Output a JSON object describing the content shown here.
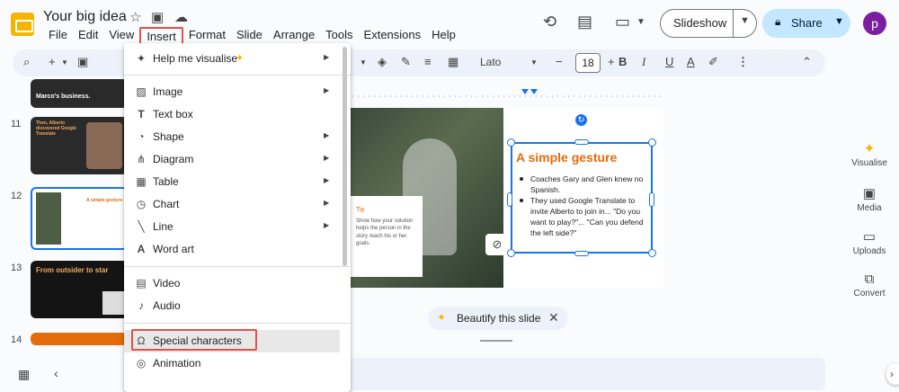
{
  "app": {
    "doc_title": "Your big idea",
    "menus": [
      "File",
      "Edit",
      "View",
      "Insert",
      "Format",
      "Slide",
      "Arrange",
      "Tools",
      "Extensions",
      "Help"
    ],
    "slideshow_label": "Slideshow",
    "share_label": "Share",
    "avatar_letter": "p",
    "accent": "#1a73e8",
    "highlight_color": "#e0524a"
  },
  "toolbar": {
    "font_name": "Lato",
    "font_size": "18"
  },
  "filmstrip": {
    "slides": [
      {
        "number": "11",
        "title": "Then, Alberto discovered Google Translate"
      },
      {
        "number": "12",
        "title": "A simple gesture"
      },
      {
        "number": "13",
        "title": "From outsider to star"
      },
      {
        "number": "14",
        "title": ""
      }
    ],
    "prev_slide_text": "Marco's business."
  },
  "slide": {
    "title": "A simple gesture",
    "bullets": [
      "Coaches Gary and Glen knew no Spanish.",
      "They used Google Translate to invite Alberto to join in... \"Do you want to play?\"... \"Can you defend the left side?\""
    ],
    "tip_label": "Tip",
    "tip_body": "Show how your solution helps the person in the story reach his or her goals."
  },
  "beautify": {
    "label": "Beautify this slide"
  },
  "side_panel": {
    "items": [
      "Visualise",
      "Media",
      "Uploads",
      "Convert"
    ]
  },
  "insert_menu": {
    "items": [
      {
        "label": "Help me visualise",
        "icon": "magic-wand-icon",
        "submenu": true
      },
      {
        "label": "Image",
        "icon": "image-icon",
        "submenu": true
      },
      {
        "label": "Text box",
        "icon": "text-box-icon",
        "submenu": false
      },
      {
        "label": "Shape",
        "icon": "shape-icon",
        "submenu": true
      },
      {
        "label": "Diagram",
        "icon": "diagram-icon",
        "submenu": true
      },
      {
        "label": "Table",
        "icon": "table-icon",
        "submenu": true
      },
      {
        "label": "Chart",
        "icon": "chart-icon",
        "submenu": true
      },
      {
        "label": "Line",
        "icon": "line-icon",
        "submenu": true
      },
      {
        "label": "Word art",
        "icon": "word-art-icon",
        "submenu": false
      },
      {
        "label": "Video",
        "icon": "video-icon",
        "submenu": false
      },
      {
        "label": "Audio",
        "icon": "audio-icon",
        "submenu": false
      },
      {
        "label": "Special characters",
        "icon": "omega-icon",
        "submenu": false
      },
      {
        "label": "Animation",
        "icon": "animation-icon",
        "submenu": false
      }
    ]
  }
}
